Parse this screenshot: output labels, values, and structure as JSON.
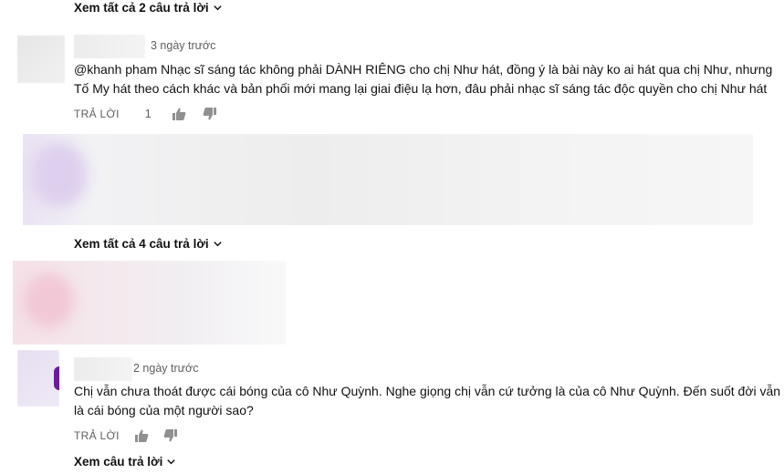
{
  "replies_link_1": "Xem tất cả 2 câu trả lời",
  "comment_1": {
    "timestamp": "3 ngày trước",
    "text_line1": "@khanh pham Nhạc sĩ sáng tác không phải DÀNH RIÊNG cho chị Như hát, đồng ý là bài này ko ai hát qua chị Như, nhưng",
    "text_line2": "Tố My hát theo cách khác và bản phối mới mang lại giai điệu lạ hơn, đâu phải nhạc sĩ sáng tác độc quyền cho chị Như hát",
    "reply_label": "TRẢ LỜI",
    "like_count": "1"
  },
  "replies_link_2": "Xem tất cả 4 câu trả lời",
  "comment_2": {
    "timestamp": "2 ngày trước",
    "text_line1": "Chị vẫn chưa thoát được cái bóng của cô Như Quỳnh. Nghe giọng chị vẫn cứ tưởng là của cô Như Quỳnh. Đến suốt đời vẫn",
    "text_line2": "là cái bóng của một người sao?",
    "reply_label": "TRẢ LỜI"
  },
  "replies_link_3": "Xem câu trả lời",
  "icons": {
    "chevron": "chevron-down-icon",
    "like": "thumb-up-icon",
    "dislike": "thumb-down-icon"
  },
  "colors": {
    "text": "#111111",
    "secondary": "#606060",
    "icon": "#909090"
  }
}
